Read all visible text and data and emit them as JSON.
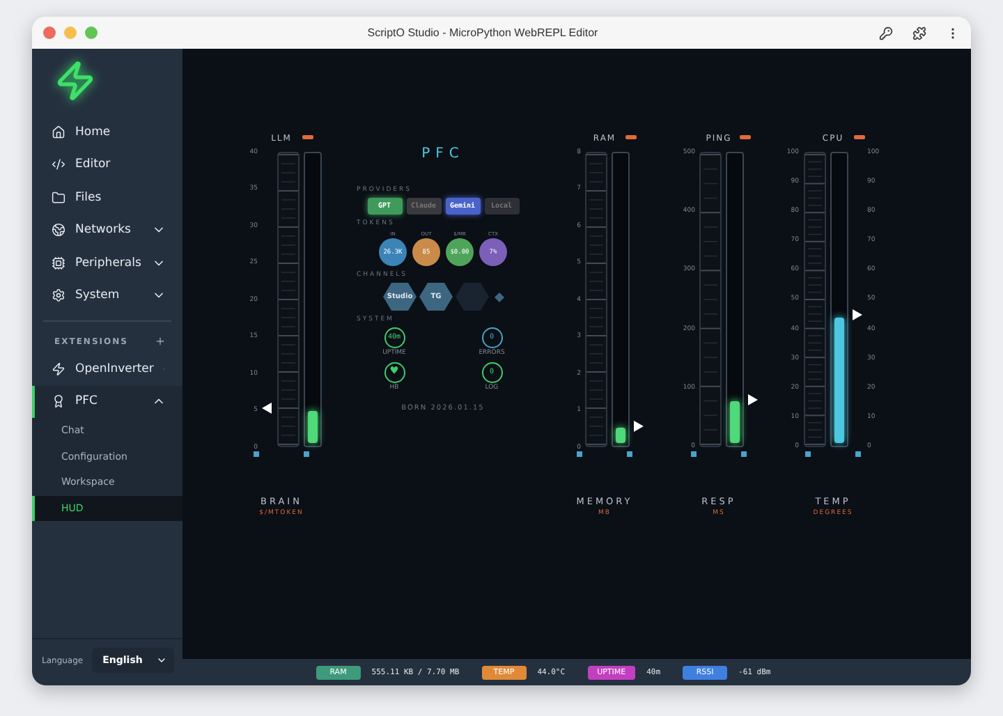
{
  "window": {
    "title": "ScriptO Studio - MicroPython WebREPL Editor"
  },
  "sidebar": {
    "items": [
      {
        "label": "Home",
        "expandable": false
      },
      {
        "label": "Editor",
        "expandable": false
      },
      {
        "label": "Files",
        "expandable": false
      },
      {
        "label": "Networks",
        "expandable": true
      },
      {
        "label": "Peripherals",
        "expandable": true
      },
      {
        "label": "System",
        "expandable": true
      }
    ],
    "extensions_heading": "EXTENSIONS",
    "extensions": [
      {
        "label": "OpenInverter",
        "expanded": false,
        "selected": false
      },
      {
        "label": "PFC",
        "expanded": true,
        "selected": true,
        "children": [
          {
            "label": "Chat",
            "selected": false
          },
          {
            "label": "Configuration",
            "selected": false
          },
          {
            "label": "Workspace",
            "selected": false
          },
          {
            "label": "HUD",
            "selected": true
          }
        ]
      }
    ],
    "language_label": "Language",
    "language": "English"
  },
  "gauges": [
    {
      "title": "LLM",
      "kind": "left",
      "ticks": [
        "40",
        "35",
        "30",
        "25",
        "20",
        "15",
        "10",
        "5",
        "0"
      ],
      "level": 0.13,
      "color": "#4fd97a",
      "caption": "BRAIN",
      "unit": "$/MTOKEN"
    },
    {
      "title": "RAM",
      "kind": "right",
      "ticks": [
        "8",
        "7",
        "6",
        "5",
        "4",
        "3",
        "2",
        "1",
        "0"
      ],
      "level": 0.07,
      "color": "#4fd97a",
      "caption": "MEMORY",
      "unit": "MB"
    },
    {
      "title": "PING",
      "kind": "right",
      "ticks": [
        "500",
        "400",
        "300",
        "200",
        "100",
        "0"
      ],
      "level": 0.16,
      "color": "#4fd97a",
      "caption": "RESP",
      "unit": "MS"
    },
    {
      "title": "CPU",
      "kind": "right",
      "ticks": [
        "100",
        "90",
        "80",
        "70",
        "60",
        "50",
        "40",
        "30",
        "20",
        "10",
        "0"
      ],
      "right_ticks": [
        "100",
        "90",
        "80",
        "70",
        "60",
        "50",
        "40",
        "30",
        "20",
        "10",
        "0"
      ],
      "level": 0.45,
      "color": "#4cc9e0",
      "caption": "TEMP",
      "unit": "DEGREES"
    }
  ],
  "panel": {
    "title": "PFC",
    "providers_heading": "PROVIDERS",
    "providers": [
      {
        "label": "GPT",
        "selected": true,
        "color": "#3f9a5c"
      },
      {
        "label": "Claude",
        "selected": false,
        "color": "#3a3a3e"
      },
      {
        "label": "Gemini",
        "selected": true,
        "color": "#4a63c9"
      },
      {
        "label": "Local",
        "selected": false,
        "color": "#2e3036"
      }
    ],
    "tokens_heading": "TOKENS",
    "tokens": [
      {
        "label": "IN",
        "value": "26.3K",
        "color": "#3c84b8"
      },
      {
        "label": "OUT",
        "value": "85",
        "color": "#c98a4a"
      },
      {
        "label": "$/MR",
        "value": "$0.00",
        "color": "#4ea55a"
      },
      {
        "label": "CTX",
        "value": "7%",
        "color": "#7b5fb8"
      }
    ],
    "channels_heading": "CHANNELS",
    "channels": [
      {
        "label": "Studio",
        "on": true
      },
      {
        "label": "TG",
        "on": true
      },
      {
        "on": false
      }
    ],
    "system_heading": "SYSTEM",
    "system": [
      {
        "kind": "text",
        "value": "40m",
        "label": "UPTIME",
        "color": "#3ecf6a"
      },
      {
        "kind": "text",
        "value": "0",
        "label": "ERRORS",
        "color": "#4aa3c9"
      },
      {
        "kind": "heart",
        "value": "♥",
        "label": "HB",
        "color": "#3ecf6a"
      },
      {
        "kind": "text",
        "value": "0",
        "label": "LOG",
        "color": "#3ecf6a"
      }
    ],
    "footer": "BORN 2026.01.15"
  },
  "status_bar": [
    {
      "label": "RAM",
      "value": "555.11 KB / 7.70 MB",
      "color": "#3d9a7a"
    },
    {
      "label": "TEMP",
      "value": "44.0°C",
      "color": "#e08a38"
    },
    {
      "label": "UPTIME",
      "value": "40m",
      "color": "#c23fc0"
    },
    {
      "label": "RSSI",
      "value": "-61 dBm",
      "color": "#3f7fe0"
    }
  ]
}
